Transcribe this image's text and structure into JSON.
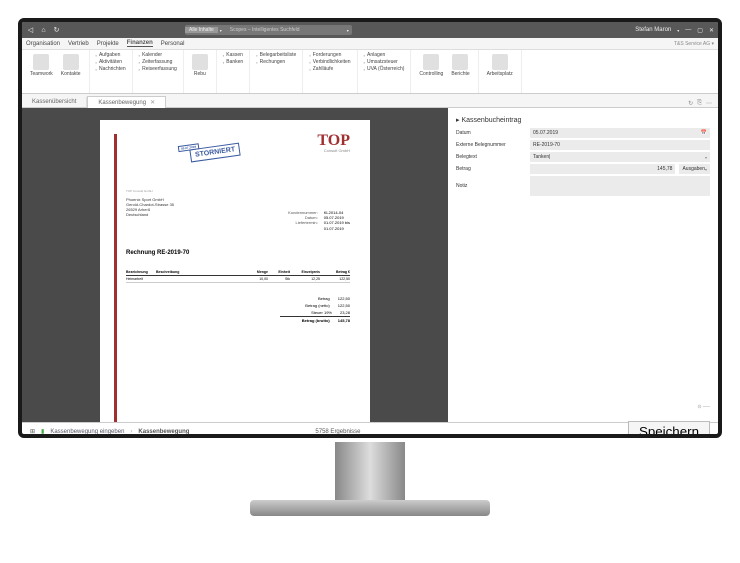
{
  "titlebar": {
    "search_label": "Alle Inhalte",
    "search_placeholder": "Scopes – Intelligentes Suchfeld",
    "user": "Stefan Maron"
  },
  "menubar": {
    "items": [
      "Organisation",
      "Vertrieb",
      "Projekte",
      "Finanzen",
      "Personal"
    ],
    "company": "T&S Service AG"
  },
  "ribbon": {
    "g1": {
      "btn1": "Teamwork",
      "btn2": "Kontakte"
    },
    "g2": [
      "Aufgaben",
      "Aktivitäten",
      "Nachrichten"
    ],
    "g3": [
      "Kalender",
      "Zeiterfassung",
      "Reiseerfassung"
    ],
    "g4": {
      "btn": "Rebu"
    },
    "g5": [
      "Kassen",
      "Banken"
    ],
    "g6": [
      "Belegarbeitsliste",
      "Rechungen"
    ],
    "g7": [
      "Forderungen",
      "Verbindlichkeiten",
      "Zahlläufe"
    ],
    "g8": [
      "Anlagen",
      "Umsatzsteuer",
      "UVA (Österreich)"
    ],
    "g9": {
      "btn1": "Controlling",
      "btn2": "Berichte"
    },
    "g10": {
      "btn": "Arbeitsplatz"
    }
  },
  "tabs": {
    "t1": "Kassenübersicht",
    "t2": "Kassenbewegung"
  },
  "document": {
    "brand": "TOP",
    "brand_sub": "Consult GmbH",
    "stamp": "STORNIERT",
    "stamp_date": "05.07.2019",
    "addr_name": "Phoenix Sport GmbH",
    "addr_street": "Gerold-Chardot-Strasse 35",
    "addr_city": "26529 Arherß",
    "addr_country": "Deutschland",
    "meta_k1": "Kundennummer:",
    "meta_v1": "KL2014-04",
    "meta_k2": "Datum:",
    "meta_v2": "05.07.2019",
    "meta_k3": "Liefertermin:",
    "meta_v3": "01.07.2019 bis",
    "meta_v3b": "01.07.2019",
    "title": "Rechnung RE-2019-70",
    "hdr": {
      "c1": "Bezeichnung",
      "c2": "Beschreibung",
      "c3": "Menge",
      "c4": "Einheit",
      "c5": "Einzelpreis",
      "c6": "Betrag €"
    },
    "line": {
      "c1": "Heimarbeit",
      "c2": "",
      "c3": "10,00",
      "c4": "Stk",
      "c5": "12,25",
      "c6": "122,50"
    },
    "totals": {
      "r1k": "Betrag",
      "r1v": "122,50",
      "r2k": "Betrag (netto)",
      "r2v": "122,50",
      "r3k": "Steuer 19%",
      "r3v": "23,28",
      "r4k": "Betrag (brutto)",
      "r4v": "145,78"
    },
    "footer": "Top Consult GmbH"
  },
  "form": {
    "title": "Kassenbucheintrag",
    "r1_label": "Datum",
    "r1_value": "05.07.2019",
    "r2_label": "Externe Belegnummer",
    "r2_value": "RE-2019-70",
    "r3_label": "Belegtext",
    "r3_value": "Tanken|",
    "r4_label": "Betrag",
    "r4_value": "145,78",
    "r4_suffix": "Ausgaben",
    "r5_label": "Notiz",
    "r5_value": ""
  },
  "status": {
    "crumb1": "Kassenbewegung eingeben",
    "crumb2": "Kassenbewegung",
    "results": "5758 Ergebnisse",
    "save": "Speichern"
  }
}
